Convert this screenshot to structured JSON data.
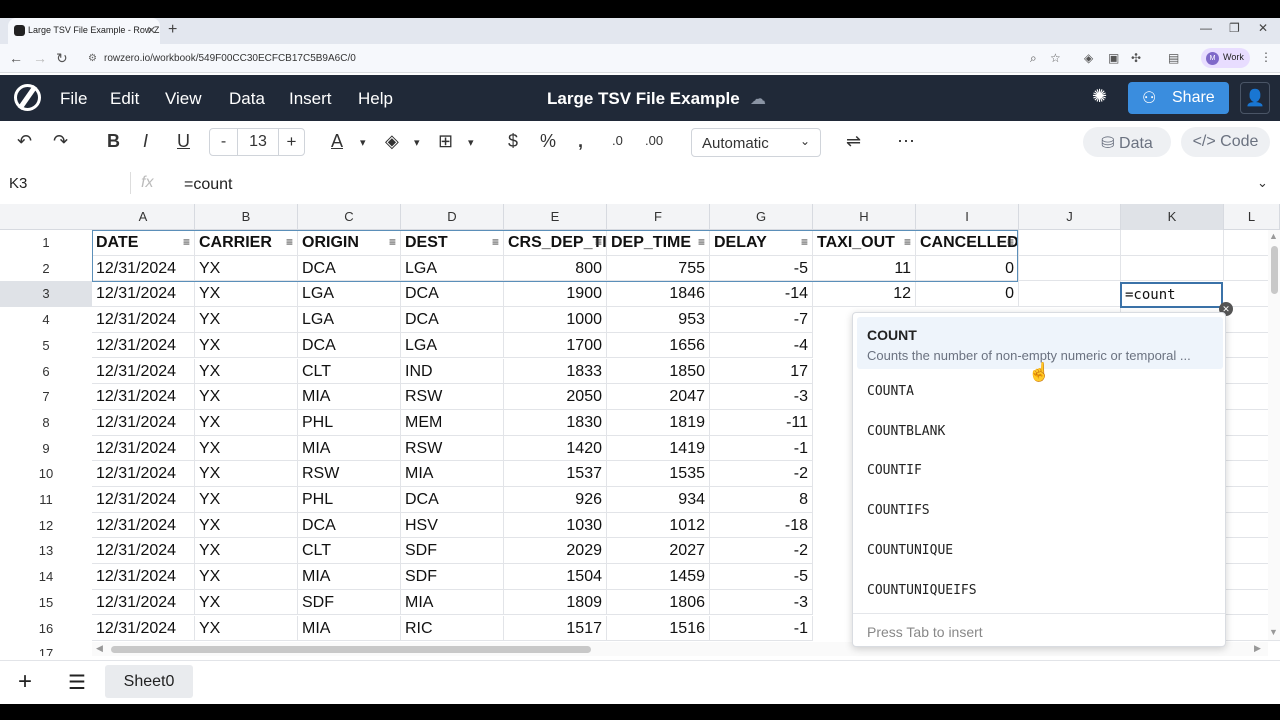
{
  "browser": {
    "tab_title": "Large TSV File Example - Row Z",
    "url": "rowzero.io/workbook/549F00CC30ECFCB17C5B9A6C/0",
    "profile_initial": "M",
    "profile_label": "Work"
  },
  "app": {
    "menu": [
      "File",
      "Edit",
      "View",
      "Data",
      "Insert",
      "Help"
    ],
    "title": "Large TSV File Example",
    "share_label": "Share"
  },
  "toolbar": {
    "font_size": "13",
    "minus": "-",
    "plus": "+",
    "number_format": "Automatic",
    "data_label": "Data",
    "code_label": "Code",
    "decimals_down": ".0",
    "decimals_up": ".00"
  },
  "formula_bar": {
    "cell_ref": "K3",
    "fx": "fx",
    "formula": "=count"
  },
  "grid": {
    "columns": [
      "A",
      "B",
      "C",
      "D",
      "E",
      "F",
      "G",
      "H",
      "I",
      "J",
      "K",
      "L"
    ],
    "header": [
      "DATE",
      "CARRIER",
      "ORIGIN",
      "DEST",
      "CRS_DEP_TIME",
      "DEP_TIME",
      "DELAY",
      "TAXI_OUT",
      "CANCELLED"
    ],
    "rows": [
      [
        "12/31/2024",
        "YX",
        "DCA",
        "LGA",
        "800",
        "755",
        "-5",
        "11",
        "0"
      ],
      [
        "12/31/2024",
        "YX",
        "LGA",
        "DCA",
        "1900",
        "1846",
        "-14",
        "12",
        "0"
      ],
      [
        "12/31/2024",
        "YX",
        "LGA",
        "DCA",
        "1000",
        "953",
        "-7",
        "",
        ""
      ],
      [
        "12/31/2024",
        "YX",
        "DCA",
        "LGA",
        "1700",
        "1656",
        "-4",
        "",
        ""
      ],
      [
        "12/31/2024",
        "YX",
        "CLT",
        "IND",
        "1833",
        "1850",
        "17",
        "",
        ""
      ],
      [
        "12/31/2024",
        "YX",
        "MIA",
        "RSW",
        "2050",
        "2047",
        "-3",
        "",
        ""
      ],
      [
        "12/31/2024",
        "YX",
        "PHL",
        "MEM",
        "1830",
        "1819",
        "-11",
        "",
        ""
      ],
      [
        "12/31/2024",
        "YX",
        "MIA",
        "RSW",
        "1420",
        "1419",
        "-1",
        "",
        ""
      ],
      [
        "12/31/2024",
        "YX",
        "RSW",
        "MIA",
        "1537",
        "1535",
        "-2",
        "",
        ""
      ],
      [
        "12/31/2024",
        "YX",
        "PHL",
        "DCA",
        "926",
        "934",
        "8",
        "",
        ""
      ],
      [
        "12/31/2024",
        "YX",
        "DCA",
        "HSV",
        "1030",
        "1012",
        "-18",
        "",
        ""
      ],
      [
        "12/31/2024",
        "YX",
        "CLT",
        "SDF",
        "2029",
        "2027",
        "-2",
        "",
        ""
      ],
      [
        "12/31/2024",
        "YX",
        "MIA",
        "SDF",
        "1504",
        "1459",
        "-5",
        "",
        ""
      ],
      [
        "12/31/2024",
        "YX",
        "SDF",
        "MIA",
        "1809",
        "1806",
        "-3",
        "",
        ""
      ],
      [
        "12/31/2024",
        "YX",
        "MIA",
        "RIC",
        "1517",
        "1516",
        "-1",
        "",
        ""
      ]
    ],
    "row_numbers": [
      "1",
      "2",
      "3",
      "4",
      "5",
      "6",
      "7",
      "8",
      "9",
      "10",
      "11",
      "12",
      "13",
      "14",
      "15",
      "16",
      "17"
    ],
    "active_cell_value": "=count"
  },
  "autocomplete": {
    "items": [
      "COUNT",
      "COUNTA",
      "COUNTBLANK",
      "COUNTIF",
      "COUNTIFS",
      "COUNTUNIQUE",
      "COUNTUNIQUEIFS"
    ],
    "selected_description": "Counts the number of non-empty numeric or temporal ...",
    "footer": "Press Tab to insert"
  },
  "sheets": {
    "tabs": [
      "Sheet0"
    ]
  },
  "colors": {
    "app_bar": "#202938",
    "share_button": "#3a8dde",
    "selection_border": "#3b72a8"
  }
}
